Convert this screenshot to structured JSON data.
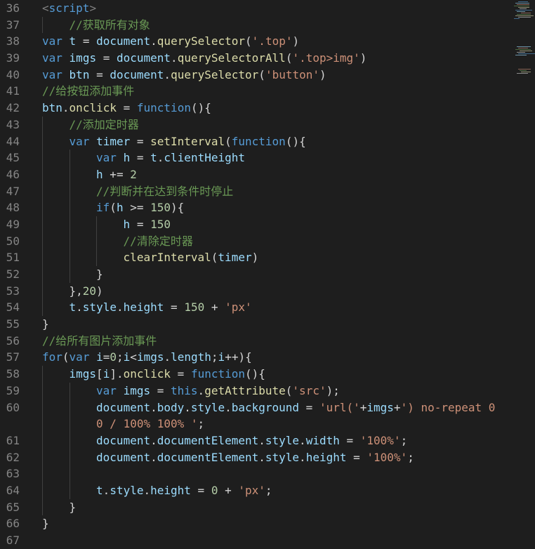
{
  "colors": {
    "background": "#1e1e1e",
    "line_number": "#858585",
    "keyword": "#569cd6",
    "identifier": "#9cdcfe",
    "function": "#dcdcaa",
    "string": "#ce9178",
    "number": "#b5cea8",
    "comment": "#6a9955",
    "plain": "#d4d4d4"
  },
  "editor": {
    "lines": [
      {
        "num": "36",
        "indent": 0,
        "tokens": [
          [
            "tag",
            "<"
          ],
          [
            "tagname",
            "script"
          ],
          [
            "tag",
            ">"
          ]
        ]
      },
      {
        "num": "37",
        "indent": 1,
        "tokens": [
          [
            "cmt",
            "//获取所有对象"
          ]
        ]
      },
      {
        "num": "38",
        "indent": 0,
        "tokens": [
          [
            "kw",
            "var"
          ],
          [
            "plain",
            " "
          ],
          [
            "id",
            "t"
          ],
          [
            "plain",
            " = "
          ],
          [
            "id",
            "document"
          ],
          [
            "plain",
            "."
          ],
          [
            "fn",
            "querySelector"
          ],
          [
            "plain",
            "("
          ],
          [
            "str",
            "'.top'"
          ],
          [
            "plain",
            ")"
          ]
        ]
      },
      {
        "num": "39",
        "indent": 0,
        "tokens": [
          [
            "kw",
            "var"
          ],
          [
            "plain",
            " "
          ],
          [
            "id",
            "imgs"
          ],
          [
            "plain",
            " = "
          ],
          [
            "id",
            "document"
          ],
          [
            "plain",
            "."
          ],
          [
            "fn",
            "querySelectorAll"
          ],
          [
            "plain",
            "("
          ],
          [
            "str",
            "'.top>img'"
          ],
          [
            "plain",
            ")"
          ]
        ]
      },
      {
        "num": "40",
        "indent": 0,
        "tokens": [
          [
            "kw",
            "var"
          ],
          [
            "plain",
            " "
          ],
          [
            "id",
            "btn"
          ],
          [
            "plain",
            " = "
          ],
          [
            "id",
            "document"
          ],
          [
            "plain",
            "."
          ],
          [
            "fn",
            "querySelector"
          ],
          [
            "plain",
            "("
          ],
          [
            "str",
            "'button'"
          ],
          [
            "plain",
            ")"
          ]
        ]
      },
      {
        "num": "41",
        "indent": 0,
        "tokens": [
          [
            "cmt",
            "//给按钮添加事件"
          ]
        ]
      },
      {
        "num": "42",
        "indent": 0,
        "tokens": [
          [
            "id",
            "btn"
          ],
          [
            "plain",
            "."
          ],
          [
            "fn",
            "onclick"
          ],
          [
            "plain",
            " = "
          ],
          [
            "kw",
            "function"
          ],
          [
            "plain",
            "(){"
          ]
        ]
      },
      {
        "num": "43",
        "indent": 1,
        "tokens": [
          [
            "cmt",
            "//添加定时器"
          ]
        ]
      },
      {
        "num": "44",
        "indent": 1,
        "tokens": [
          [
            "kw",
            "var"
          ],
          [
            "plain",
            " "
          ],
          [
            "id",
            "timer"
          ],
          [
            "plain",
            " = "
          ],
          [
            "fn",
            "setInterval"
          ],
          [
            "plain",
            "("
          ],
          [
            "kw",
            "function"
          ],
          [
            "plain",
            "(){"
          ]
        ]
      },
      {
        "num": "45",
        "indent": 2,
        "tokens": [
          [
            "kw",
            "var"
          ],
          [
            "plain",
            " "
          ],
          [
            "id",
            "h"
          ],
          [
            "plain",
            " = "
          ],
          [
            "id",
            "t"
          ],
          [
            "plain",
            "."
          ],
          [
            "id",
            "clientHeight"
          ]
        ]
      },
      {
        "num": "46",
        "indent": 2,
        "tokens": [
          [
            "id",
            "h"
          ],
          [
            "plain",
            " += "
          ],
          [
            "num",
            "2"
          ]
        ]
      },
      {
        "num": "47",
        "indent": 2,
        "tokens": [
          [
            "cmt",
            "//判断并在达到条件时停止"
          ]
        ]
      },
      {
        "num": "48",
        "indent": 2,
        "tokens": [
          [
            "kw",
            "if"
          ],
          [
            "plain",
            "("
          ],
          [
            "id",
            "h"
          ],
          [
            "plain",
            " >= "
          ],
          [
            "num",
            "150"
          ],
          [
            "plain",
            "){"
          ]
        ]
      },
      {
        "num": "49",
        "indent": 3,
        "tokens": [
          [
            "id",
            "h"
          ],
          [
            "plain",
            " = "
          ],
          [
            "num",
            "150"
          ]
        ]
      },
      {
        "num": "50",
        "indent": 3,
        "tokens": [
          [
            "cmt",
            "//清除定时器"
          ]
        ]
      },
      {
        "num": "51",
        "indent": 3,
        "tokens": [
          [
            "fn",
            "clearInterval"
          ],
          [
            "plain",
            "("
          ],
          [
            "id",
            "timer"
          ],
          [
            "plain",
            ")"
          ]
        ]
      },
      {
        "num": "52",
        "indent": 2,
        "tokens": [
          [
            "plain",
            "}"
          ]
        ]
      },
      {
        "num": "53",
        "indent": 1,
        "tokens": [
          [
            "plain",
            "},"
          ],
          [
            "num",
            "20"
          ],
          [
            "plain",
            ")"
          ]
        ]
      },
      {
        "num": "54",
        "indent": 1,
        "tokens": [
          [
            "id",
            "t"
          ],
          [
            "plain",
            "."
          ],
          [
            "id",
            "style"
          ],
          [
            "plain",
            "."
          ],
          [
            "id",
            "height"
          ],
          [
            "plain",
            " = "
          ],
          [
            "num",
            "150"
          ],
          [
            "plain",
            " + "
          ],
          [
            "str",
            "'px'"
          ]
        ]
      },
      {
        "num": "55",
        "indent": 0,
        "tokens": [
          [
            "plain",
            "}"
          ]
        ]
      },
      {
        "num": "56",
        "indent": 0,
        "tokens": [
          [
            "cmt",
            "//给所有图片添加事件"
          ]
        ]
      },
      {
        "num": "57",
        "indent": 0,
        "tokens": [
          [
            "kw",
            "for"
          ],
          [
            "plain",
            "("
          ],
          [
            "kw",
            "var"
          ],
          [
            "plain",
            " "
          ],
          [
            "id",
            "i"
          ],
          [
            "plain",
            "="
          ],
          [
            "num",
            "0"
          ],
          [
            "plain",
            ";"
          ],
          [
            "id",
            "i"
          ],
          [
            "plain",
            "<"
          ],
          [
            "id",
            "imgs"
          ],
          [
            "plain",
            "."
          ],
          [
            "id",
            "length"
          ],
          [
            "plain",
            ";"
          ],
          [
            "id",
            "i"
          ],
          [
            "plain",
            "++){"
          ]
        ]
      },
      {
        "num": "58",
        "indent": 1,
        "tokens": [
          [
            "id",
            "imgs"
          ],
          [
            "plain",
            "["
          ],
          [
            "id",
            "i"
          ],
          [
            "plain",
            "]."
          ],
          [
            "fn",
            "onclick"
          ],
          [
            "plain",
            " = "
          ],
          [
            "kw",
            "function"
          ],
          [
            "plain",
            "(){"
          ]
        ]
      },
      {
        "num": "59",
        "indent": 2,
        "tokens": [
          [
            "kw",
            "var"
          ],
          [
            "plain",
            " "
          ],
          [
            "id",
            "imgs"
          ],
          [
            "plain",
            " = "
          ],
          [
            "kw",
            "this"
          ],
          [
            "plain",
            "."
          ],
          [
            "fn",
            "getAttribute"
          ],
          [
            "plain",
            "("
          ],
          [
            "str",
            "'src'"
          ],
          [
            "plain",
            ");"
          ]
        ]
      },
      {
        "num": "60",
        "indent": 2,
        "tokens": [
          [
            "id",
            "document"
          ],
          [
            "plain",
            "."
          ],
          [
            "id",
            "body"
          ],
          [
            "plain",
            "."
          ],
          [
            "id",
            "style"
          ],
          [
            "plain",
            "."
          ],
          [
            "id",
            "background"
          ],
          [
            "plain",
            " = "
          ],
          [
            "str",
            "'url('"
          ],
          [
            "plain",
            "+"
          ],
          [
            "id",
            "imgs"
          ],
          [
            "plain",
            "+"
          ],
          [
            "str",
            "') no-repeat 0"
          ]
        ]
      },
      {
        "num": "",
        "indent": 2,
        "tokens": [
          [
            "str",
            "0 / 100% 100% '"
          ],
          [
            "plain",
            ";"
          ]
        ]
      },
      {
        "num": "61",
        "indent": 2,
        "tokens": [
          [
            "id",
            "document"
          ],
          [
            "plain",
            "."
          ],
          [
            "id",
            "documentElement"
          ],
          [
            "plain",
            "."
          ],
          [
            "id",
            "style"
          ],
          [
            "plain",
            "."
          ],
          [
            "id",
            "width"
          ],
          [
            "plain",
            " = "
          ],
          [
            "str",
            "'100%'"
          ],
          [
            "plain",
            ";"
          ]
        ]
      },
      {
        "num": "62",
        "indent": 2,
        "tokens": [
          [
            "id",
            "document"
          ],
          [
            "plain",
            "."
          ],
          [
            "id",
            "documentElement"
          ],
          [
            "plain",
            "."
          ],
          [
            "id",
            "style"
          ],
          [
            "plain",
            "."
          ],
          [
            "id",
            "height"
          ],
          [
            "plain",
            " = "
          ],
          [
            "str",
            "'100%'"
          ],
          [
            "plain",
            ";"
          ]
        ]
      },
      {
        "num": "63",
        "indent": 2,
        "tokens": []
      },
      {
        "num": "64",
        "indent": 2,
        "tokens": [
          [
            "id",
            "t"
          ],
          [
            "plain",
            "."
          ],
          [
            "id",
            "style"
          ],
          [
            "plain",
            "."
          ],
          [
            "id",
            "height"
          ],
          [
            "plain",
            " = "
          ],
          [
            "num",
            "0"
          ],
          [
            "plain",
            " + "
          ],
          [
            "str",
            "'px'"
          ],
          [
            "plain",
            ";"
          ]
        ]
      },
      {
        "num": "65",
        "indent": 1,
        "tokens": [
          [
            "plain",
            "}"
          ]
        ]
      },
      {
        "num": "66",
        "indent": 0,
        "tokens": [
          [
            "plain",
            "}"
          ]
        ]
      },
      {
        "num": "67",
        "indent": 0,
        "tokens": []
      }
    ]
  }
}
